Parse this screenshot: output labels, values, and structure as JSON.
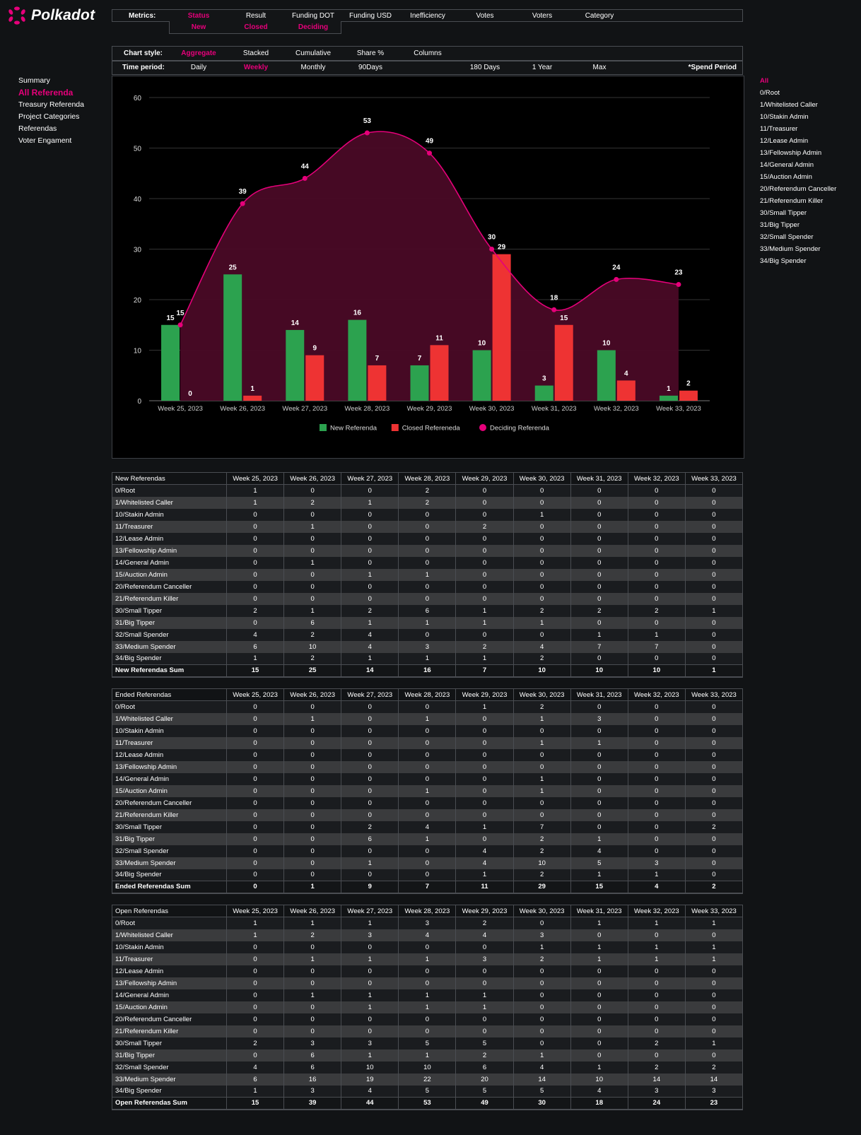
{
  "logo": {
    "text": "Polkadot"
  },
  "metrics": {
    "label": "Metrics:",
    "items": [
      "Status",
      "Result",
      "Funding DOT",
      "Funding USD",
      "Inefficiency",
      "Votes",
      "Voters",
      "Category"
    ],
    "selected": "Status",
    "sub_items": [
      "New",
      "Closed",
      "Deciding"
    ]
  },
  "chart_style": {
    "label": "Chart style:",
    "items": [
      "Aggregate",
      "Stacked",
      "Cumulative",
      "Share %",
      "Columns"
    ],
    "selected": "Aggregate"
  },
  "time_period": {
    "label": "Time period:",
    "items": [
      "Daily",
      "Weekly",
      "Monthly",
      "90Days",
      "180 Days",
      "1 Year",
      "Max"
    ],
    "selected": "Weekly",
    "spend_period": "*Spend Period"
  },
  "nav_left": {
    "items": [
      "Summary",
      "All Referenda",
      "Treasury Referenda",
      "Project Categories",
      "Referendas",
      "Voter Engament"
    ],
    "active": "All Referenda"
  },
  "nav_right": {
    "items": [
      "All",
      "0/Root",
      "1/Whitelisted Caller",
      "10/Stakin Admin",
      "11/Treasurer",
      "12/Lease Admin",
      "13/Fellowship Admin",
      "14/General Admin",
      "15/Auction Admin",
      "20/Referendum Canceller",
      "21/Referendum Killer",
      "30/Small Tipper",
      "31/Big Tipper",
      "32/Small Spender",
      "33/Medium Spender",
      "34/Big Spender"
    ],
    "active": "All"
  },
  "colors": {
    "accent": "#e6007a",
    "green": "#2ca24f",
    "red": "#ee3333",
    "area": "#4a0a26"
  },
  "chart_data": {
    "type": "bar",
    "categories": [
      "Week 25, 2023",
      "Week 26, 2023",
      "Week 27, 2023",
      "Week 28, 2023",
      "Week 29, 2023",
      "Week 30, 2023",
      "Week 31, 2023",
      "Week 32, 2023",
      "Week 33, 2023"
    ],
    "series": [
      {
        "name": "New Referenda",
        "kind": "bar",
        "color": "#2ca24f",
        "values": [
          15,
          25,
          14,
          16,
          7,
          10,
          3,
          10,
          1
        ]
      },
      {
        "name": "Closed Refereneda",
        "kind": "bar",
        "color": "#ee3333",
        "values": [
          0,
          1,
          9,
          7,
          11,
          29,
          15,
          4,
          2
        ]
      },
      {
        "name": "Deciding Referenda",
        "kind": "area",
        "color": "#e6007a",
        "values": [
          15,
          39,
          44,
          53,
          49,
          30,
          18,
          24,
          23
        ]
      }
    ],
    "y_ticks": [
      0,
      10,
      20,
      30,
      40,
      50,
      60
    ],
    "ylim": [
      0,
      60
    ],
    "grid": true,
    "legend": "bottom"
  },
  "col_headers": [
    "Week 25, 2023",
    "Week 26, 2023",
    "Week 27, 2023",
    "Week 28, 2023",
    "Week 29, 2023",
    "Week 30, 2023",
    "Week 31, 2023",
    "Week 32, 2023",
    "Week 33, 2023"
  ],
  "tables": [
    {
      "title": "New Referendas",
      "rows": [
        [
          "0/Root",
          1,
          0,
          0,
          2,
          0,
          0,
          0,
          0,
          0
        ],
        [
          "1/Whitelisted Caller",
          1,
          2,
          1,
          2,
          0,
          0,
          0,
          0,
          0
        ],
        [
          "10/Stakin Admin",
          0,
          0,
          0,
          0,
          0,
          1,
          0,
          0,
          0
        ],
        [
          "11/Treasurer",
          0,
          1,
          0,
          0,
          2,
          0,
          0,
          0,
          0
        ],
        [
          "12/Lease Admin",
          0,
          0,
          0,
          0,
          0,
          0,
          0,
          0,
          0
        ],
        [
          "13/Fellowship Admin",
          0,
          0,
          0,
          0,
          0,
          0,
          0,
          0,
          0
        ],
        [
          "14/General Admin",
          0,
          1,
          0,
          0,
          0,
          0,
          0,
          0,
          0
        ],
        [
          "15/Auction Admin",
          0,
          0,
          1,
          1,
          0,
          0,
          0,
          0,
          0
        ],
        [
          "20/Referendum Canceller",
          0,
          0,
          0,
          0,
          0,
          0,
          0,
          0,
          0
        ],
        [
          "21/Referendum Killer",
          0,
          0,
          0,
          0,
          0,
          0,
          0,
          0,
          0
        ],
        [
          "30/Small Tipper",
          2,
          1,
          2,
          6,
          1,
          2,
          2,
          2,
          1
        ],
        [
          "31/Big Tipper",
          0,
          6,
          1,
          1,
          1,
          1,
          0,
          0,
          0
        ],
        [
          "32/Small Spender",
          4,
          2,
          4,
          0,
          0,
          0,
          1,
          1,
          0
        ],
        [
          "33/Medium Spender",
          6,
          10,
          4,
          3,
          2,
          4,
          7,
          7,
          0
        ],
        [
          "34/Big Spender",
          1,
          2,
          1,
          1,
          1,
          2,
          0,
          0,
          0
        ]
      ],
      "sum_label": "New Referendas Sum",
      "sums": [
        15,
        25,
        14,
        16,
        7,
        10,
        10,
        10,
        1
      ]
    },
    {
      "title": "Ended Referendas",
      "rows": [
        [
          "0/Root",
          0,
          0,
          0,
          0,
          1,
          2,
          0,
          0,
          0
        ],
        [
          "1/Whitelisted Caller",
          0,
          1,
          0,
          1,
          0,
          1,
          3,
          0,
          0
        ],
        [
          "10/Stakin Admin",
          0,
          0,
          0,
          0,
          0,
          0,
          0,
          0,
          0
        ],
        [
          "11/Treasurer",
          0,
          0,
          0,
          0,
          0,
          1,
          1,
          0,
          0
        ],
        [
          "12/Lease Admin",
          0,
          0,
          0,
          0,
          0,
          0,
          0,
          0,
          0
        ],
        [
          "13/Fellowship Admin",
          0,
          0,
          0,
          0,
          0,
          0,
          0,
          0,
          0
        ],
        [
          "14/General Admin",
          0,
          0,
          0,
          0,
          0,
          1,
          0,
          0,
          0
        ],
        [
          "15/Auction Admin",
          0,
          0,
          0,
          1,
          0,
          1,
          0,
          0,
          0
        ],
        [
          "20/Referendum Canceller",
          0,
          0,
          0,
          0,
          0,
          0,
          0,
          0,
          0
        ],
        [
          "21/Referendum Killer",
          0,
          0,
          0,
          0,
          0,
          0,
          0,
          0,
          0
        ],
        [
          "30/Small Tipper",
          0,
          0,
          2,
          4,
          1,
          7,
          0,
          0,
          2
        ],
        [
          "31/Big Tipper",
          0,
          0,
          6,
          1,
          0,
          2,
          1,
          0,
          0
        ],
        [
          "32/Small Spender",
          0,
          0,
          0,
          0,
          4,
          2,
          4,
          0,
          0
        ],
        [
          "33/Medium Spender",
          0,
          0,
          1,
          0,
          4,
          10,
          5,
          3,
          0
        ],
        [
          "34/Big Spender",
          0,
          0,
          0,
          0,
          1,
          2,
          1,
          1,
          0
        ]
      ],
      "sum_label": "Ended Referendas Sum",
      "sums": [
        0,
        1,
        9,
        7,
        11,
        29,
        15,
        4,
        2
      ]
    },
    {
      "title": "Open Referendas",
      "rows": [
        [
          "0/Root",
          1,
          1,
          1,
          3,
          2,
          0,
          1,
          1,
          1
        ],
        [
          "1/Whitelisted Caller",
          1,
          2,
          3,
          4,
          4,
          3,
          0,
          0,
          0
        ],
        [
          "10/Stakin Admin",
          0,
          0,
          0,
          0,
          0,
          1,
          1,
          1,
          1
        ],
        [
          "11/Treasurer",
          0,
          1,
          1,
          1,
          3,
          2,
          1,
          1,
          1
        ],
        [
          "12/Lease Admin",
          0,
          0,
          0,
          0,
          0,
          0,
          0,
          0,
          0
        ],
        [
          "13/Fellowship Admin",
          0,
          0,
          0,
          0,
          0,
          0,
          0,
          0,
          0
        ],
        [
          "14/General Admin",
          0,
          1,
          1,
          1,
          1,
          0,
          0,
          0,
          0
        ],
        [
          "15/Auction Admin",
          0,
          0,
          1,
          1,
          1,
          0,
          0,
          0,
          0
        ],
        [
          "20/Referendum Canceller",
          0,
          0,
          0,
          0,
          0,
          0,
          0,
          0,
          0
        ],
        [
          "21/Referendum Killer",
          0,
          0,
          0,
          0,
          0,
          0,
          0,
          0,
          0
        ],
        [
          "30/Small Tipper",
          2,
          3,
          3,
          5,
          5,
          0,
          0,
          2,
          1
        ],
        [
          "31/Big Tipper",
          0,
          6,
          1,
          1,
          2,
          1,
          0,
          0,
          0
        ],
        [
          "32/Small Spender",
          4,
          6,
          10,
          10,
          6,
          4,
          1,
          2,
          2
        ],
        [
          "33/Medium Spender",
          6,
          16,
          19,
          22,
          20,
          14,
          10,
          14,
          14
        ],
        [
          "34/Big Spender",
          1,
          3,
          4,
          5,
          5,
          5,
          4,
          3,
          3
        ]
      ],
      "sum_label": "Open Referendas Sum",
      "sums": [
        15,
        39,
        44,
        53,
        49,
        30,
        18,
        24,
        23
      ]
    }
  ]
}
